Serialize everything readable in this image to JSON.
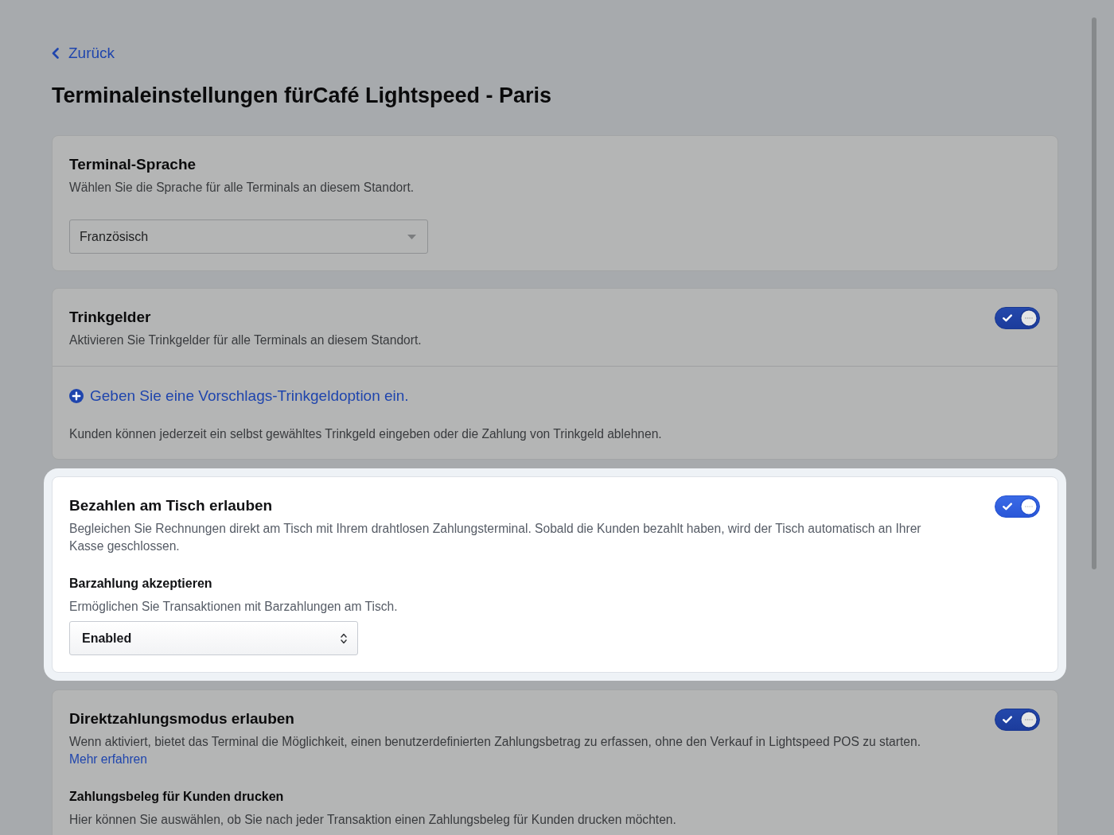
{
  "back_link": {
    "label": "Zurück"
  },
  "title": "Terminaleinstellungen fürCafé Lightspeed - Paris",
  "cards": [
    {
      "highlighted": false,
      "title": "Terminal-Sprache",
      "description": "Wählen Sie die Sprache für alle Terminals an diesem Standort.",
      "blocks": [
        {
          "kind": "dropdown",
          "value": "Französisch"
        }
      ]
    },
    {
      "highlighted": false,
      "title": "Trinkgelder",
      "description": "Aktivieren Sie Trinkgelder für alle Terminals an diesem Standort.",
      "toggle": {
        "on": true
      },
      "footer": [
        {
          "kind": "add_link",
          "label": "Geben Sie eine Vorschlags-Trinkgeldoption ein."
        },
        {
          "kind": "note",
          "text": "Kunden können jederzeit ein selbst gewähltes Trinkgeld eingeben oder die Zahlung von Trinkgeld ablehnen."
        }
      ]
    },
    {
      "highlighted": true,
      "title": "Bezahlen am Tisch erlauben",
      "description": "Begleichen Sie Rechnungen direkt am Tisch mit Ihrem drahtlosen Zahlungsterminal. Sobald die Kunden bezahlt haben, wird der Tisch automatisch an Ihrer Kasse geschlossen.",
      "toggle": {
        "on": true
      },
      "blocks": [
        {
          "kind": "subheading",
          "text": "Barzahlung akzeptieren"
        },
        {
          "kind": "text",
          "text": "Ermöglichen Sie Transaktionen mit Barzahlungen am Tisch."
        },
        {
          "kind": "select",
          "value": "Enabled"
        }
      ]
    },
    {
      "highlighted": false,
      "title": "Direktzahlungsmodus erlauben",
      "description": "Wenn aktiviert, bietet das Terminal die Möglichkeit, einen benutzerdefinierten Zahlungsbetrag zu erfassen, ohne den Verkauf in Lightspeed POS zu starten.",
      "link": "Mehr erfahren",
      "toggle": {
        "on": true
      },
      "blocks": [
        {
          "kind": "subheading",
          "text": "Zahlungsbeleg für Kunden drucken"
        },
        {
          "kind": "text",
          "text": "Hier können Sie auswählen, ob Sie nach jeder Transaktion einen Zahlungsbeleg für Kunden drucken möchten."
        }
      ]
    }
  ]
}
